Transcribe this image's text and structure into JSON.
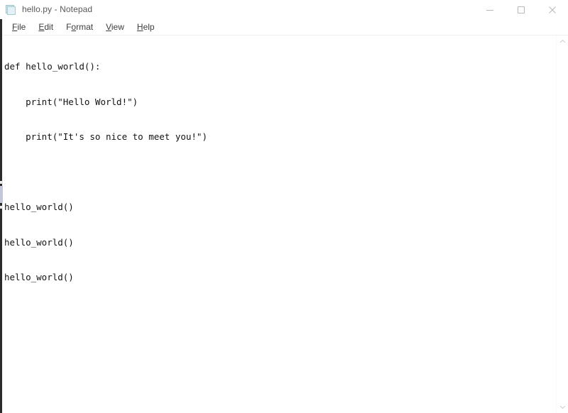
{
  "window": {
    "title": "hello.py - Notepad",
    "app_icon": "notepad-icon",
    "controls": {
      "minimize_label": "Minimize",
      "maximize_label": "Maximize",
      "close_label": "Close"
    }
  },
  "menu_bar": {
    "items": [
      {
        "label": "File",
        "accesskey": "F",
        "before": "",
        "after": "ile"
      },
      {
        "label": "Edit",
        "accesskey": "E",
        "before": "",
        "after": "dit"
      },
      {
        "label": "Format",
        "accesskey": "o",
        "before": "F",
        "after": "rmat"
      },
      {
        "label": "View",
        "accesskey": "V",
        "before": "",
        "after": "iew"
      },
      {
        "label": "Help",
        "accesskey": "H",
        "before": "",
        "after": "elp"
      }
    ]
  },
  "editor": {
    "lines": [
      "def hello_world():",
      "    print(\"Hello World!\")",
      "    print(\"It's so nice to meet you!\")",
      "",
      "hello_world()",
      "hello_world()",
      "hello_world()"
    ],
    "text": "def hello_world():\n    print(\"Hello World!\")\n    print(\"It's so nice to meet you!\")\n\nhello_world()\nhello_world()\nhello_world()"
  },
  "scrollbar": {
    "up_arrow": "chevron-up-icon",
    "down_arrow": "chevron-down-icon"
  },
  "colors": {
    "window_background": "#ffffff",
    "title_text": "#5a5a5a",
    "menu_text": "#3c3c3c",
    "code_text": "#121212",
    "control_glyph": "#b8b8b8",
    "icon_accent": "#cfe6ea"
  }
}
